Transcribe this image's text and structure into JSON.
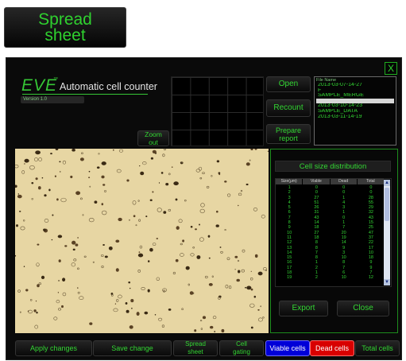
{
  "top_button": {
    "label": "Spread\nsheet"
  },
  "close_label": "X",
  "brand": {
    "logo": "EVE",
    "tm": "™",
    "title": "Automatic cell counter",
    "version": "Version 1.0"
  },
  "buttons": {
    "zoom_out": "Zoom\nout",
    "open": "Open",
    "recount": "Recount",
    "prepare_report": "Prepare\nreport",
    "export": "Export",
    "close": "Close"
  },
  "file_list": {
    "header": "File Name",
    "items": [
      "2013-03-07-14-27",
      "F",
      "SAMPLE_MERGE",
      "SAMPLE_F",
      "2013-03-10-14-23",
      "SAMPLE_DATA",
      "2013-03-11-14-19"
    ],
    "selected_index": 3
  },
  "distribution": {
    "title": "Cell size distribution",
    "columns": [
      "Size(μm)",
      "Viable",
      "Dead",
      "Total"
    ],
    "rows": [
      [
        "1",
        "0",
        "0",
        "0"
      ],
      [
        "2",
        "0",
        "0",
        "0"
      ],
      [
        "3",
        "27",
        "1",
        "28"
      ],
      [
        "4",
        "51",
        "4",
        "55"
      ],
      [
        "5",
        "26",
        "3",
        "29"
      ],
      [
        "6",
        "31",
        "1",
        "32"
      ],
      [
        "7",
        "43",
        "0",
        "43"
      ],
      [
        "8",
        "14",
        "1",
        "15"
      ],
      [
        "9",
        "18",
        "7",
        "25"
      ],
      [
        "10",
        "27",
        "20",
        "47"
      ],
      [
        "11",
        "18",
        "19",
        "37"
      ],
      [
        "12",
        "8",
        "14",
        "22"
      ],
      [
        "13",
        "8",
        "9",
        "17"
      ],
      [
        "14",
        "7",
        "3",
        "10"
      ],
      [
        "15",
        "8",
        "10",
        "18"
      ],
      [
        "16",
        "1",
        "8",
        "9"
      ],
      [
        "17",
        "2",
        "7",
        "9"
      ],
      [
        "18",
        "1",
        "6",
        "7"
      ],
      [
        "19",
        "2",
        "10",
        "12"
      ]
    ]
  },
  "bottom_buttons": {
    "apply": "Apply changes",
    "save": "Save change",
    "spreadsheet": "Spread\nsheet",
    "gating": "Cell\ngating",
    "viable": "Viable cells",
    "dead": "Dead cells",
    "total": "Total cells"
  },
  "colors": {
    "accent": "#33d633",
    "viable": "#0000d8",
    "dead": "#d80000",
    "image_bg": "#e7d6a3"
  },
  "icons": {
    "scroll_up": "scroll-up-arrow-icon",
    "scroll_down": "scroll-down-arrow-icon"
  }
}
